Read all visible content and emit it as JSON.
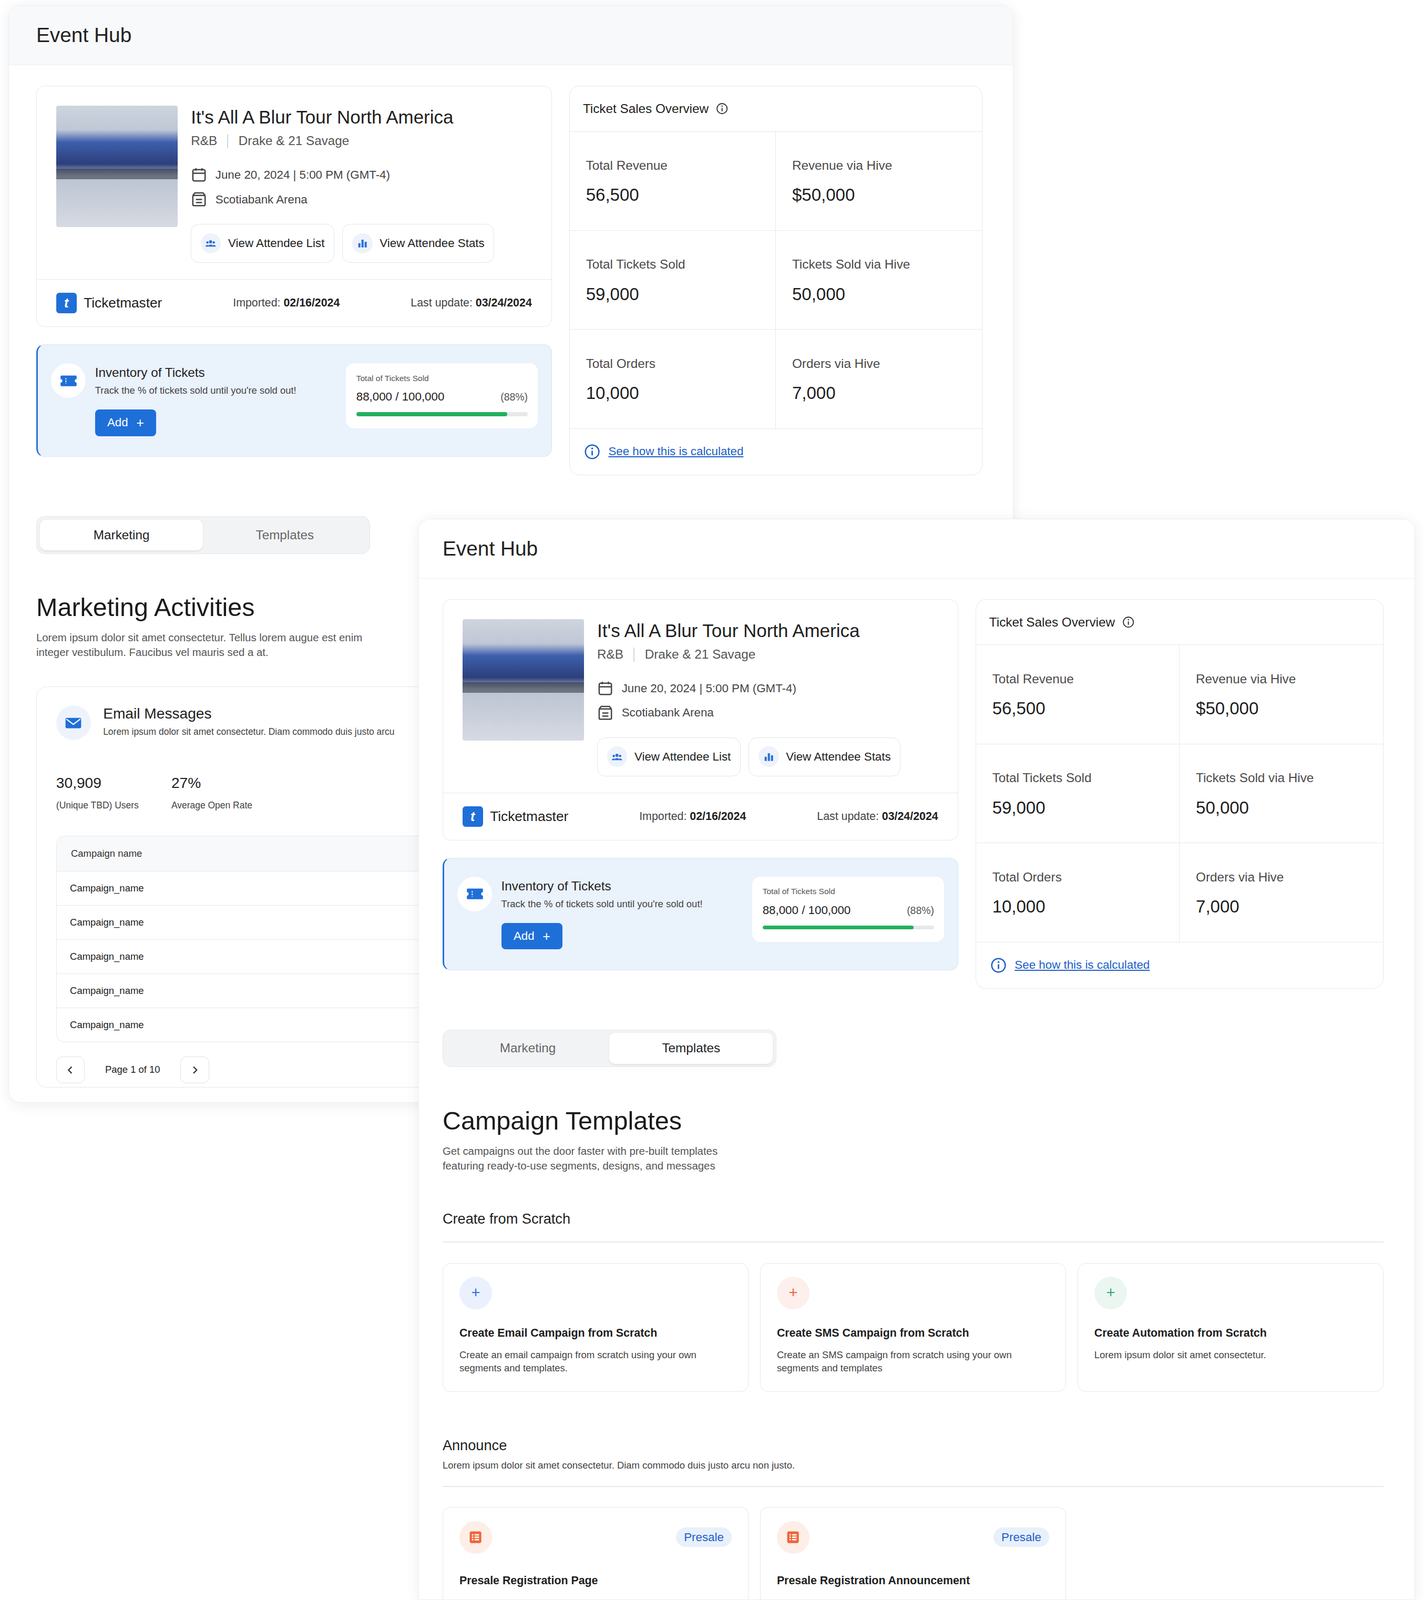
{
  "windows": [
    {
      "title": "Event Hub",
      "event": {
        "title": "It's All A Blur Tour North America",
        "genre": "R&B",
        "artists": "Drake & 21 Savage",
        "date": "June 20, 2024 | 5:00 PM (GMT-4)",
        "venue": "Scotiabank Arena",
        "actions": [
          "View Attendee List",
          "View Attendee Stats"
        ],
        "source": {
          "logo": "t",
          "name": "Ticketmaster",
          "imported_label": "Imported:",
          "imported": "02/16/2024",
          "updated_label": "Last update:",
          "updated": "03/24/2024"
        }
      },
      "inventory": {
        "title": "Inventory of Tickets",
        "description": "Track the % of tickets sold until you're sold out!",
        "button": "Add",
        "button_icon": "+",
        "meter": {
          "label": "Total of Tickets Sold",
          "reading": "88,000 / 100,000",
          "percent": "(88%)",
          "level": 0.88
        }
      },
      "sales": {
        "title": "Ticket Sales Overview",
        "stats": [
          {
            "label": "Total Revenue",
            "value": "56,500"
          },
          {
            "label": "Revenue via Hive",
            "value": "$50,000"
          },
          {
            "label": "Total Tickets Sold",
            "value": "59,000"
          },
          {
            "label": "Tickets Sold via Hive",
            "value": "50,000"
          },
          {
            "label": "Total Orders",
            "value": "10,000"
          },
          {
            "label": "Orders via Hive",
            "value": "7,000"
          }
        ],
        "link": "See how this is calculated"
      },
      "tabs": [
        {
          "label": "Marketing",
          "selected": true
        },
        {
          "label": "Templates",
          "selected": false
        }
      ],
      "marketing": {
        "title": "Marketing Activities",
        "description": "Lorem ipsum dolor sit amet consectetur. Tellus lorem augue est enim integer vestibulum. Faucibus vel mauris sed a at.",
        "email": {
          "title": "Email Messages",
          "description": "Lorem ipsum dolor sit amet consectetur. Diam commodo duis justo arcu",
          "stats": [
            {
              "value": "30,909",
              "label": "(Unique TBD) Users"
            },
            {
              "value": "27%",
              "label": "Average Open Rate"
            }
          ],
          "columns": [
            "Campaign name"
          ],
          "rows": [
            "Campaign_name",
            "Campaign_name",
            "Campaign_name",
            "Campaign_name",
            "Campaign_name"
          ],
          "page": "Page 1 of 10"
        }
      }
    },
    {
      "title": "Event Hub",
      "event": {
        "title": "It's All A Blur Tour North America",
        "genre": "R&B",
        "artists": "Drake & 21 Savage",
        "date": "June 20, 2024 | 5:00 PM (GMT-4)",
        "venue": "Scotiabank Arena",
        "actions": [
          "View Attendee List",
          "View Attendee Stats"
        ],
        "source": {
          "logo": "t",
          "name": "Ticketmaster",
          "imported_label": "Imported:",
          "imported": "02/16/2024",
          "updated_label": "Last update:",
          "updated": "03/24/2024"
        }
      },
      "inventory": {
        "title": "Inventory of Tickets",
        "description": "Track the % of tickets sold until you're sold out!",
        "button": "Add",
        "button_icon": "+",
        "meter": {
          "label": "Total of Tickets Sold",
          "reading": "88,000 / 100,000",
          "percent": "(88%)",
          "level": 0.88
        }
      },
      "sales": {
        "title": "Ticket Sales Overview",
        "stats": [
          {
            "label": "Total Revenue",
            "value": "56,500"
          },
          {
            "label": "Revenue via Hive",
            "value": "$50,000"
          },
          {
            "label": "Total Tickets Sold",
            "value": "59,000"
          },
          {
            "label": "Tickets Sold via Hive",
            "value": "50,000"
          },
          {
            "label": "Total Orders",
            "value": "10,000"
          },
          {
            "label": "Orders via Hive",
            "value": "7,000"
          }
        ],
        "link": "See how this is calculated"
      },
      "tabs": [
        {
          "label": "Marketing",
          "selected": false
        },
        {
          "label": "Templates",
          "selected": true
        }
      ],
      "templates": {
        "title": "Campaign Templates",
        "description": "Get campaigns out the door faster with pre-built templates featuring ready-to-use segments, designs, and messages",
        "scratch": {
          "title": "Create from Scratch",
          "cards": [
            {
              "icon": "+",
              "title": "Create Email Campaign from Scratch",
              "description": "Create an email campaign from scratch using your own segments and templates.",
              "color": "#2f6fe0"
            },
            {
              "icon": "+",
              "title": "Create SMS Campaign from Scratch",
              "description": "Create an SMS campaign from scratch using your own segments and templates",
              "color": "#f0643a"
            },
            {
              "icon": "+",
              "title": "Create Automation from Scratch",
              "description": "Lorem ipsum dolor sit amet consectetur.",
              "color": "#3aa676"
            }
          ]
        },
        "announce": {
          "title": "Announce",
          "description": "Lorem ipsum dolor sit amet consectetur. Diam commodo duis justo arcu non justo.",
          "cards": [
            {
              "title": "Presale Registration Page",
              "tag": "Presale"
            },
            {
              "title": "Presale Registration Announcement",
              "tag": "Presale"
            }
          ]
        }
      }
    }
  ]
}
